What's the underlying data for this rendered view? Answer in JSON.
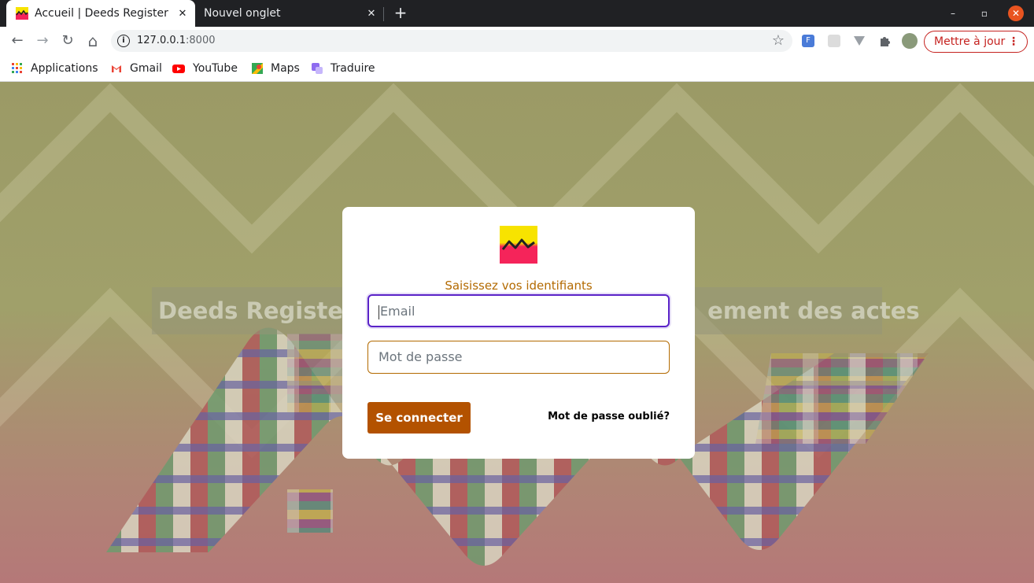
{
  "browser": {
    "tabs": [
      {
        "title": "Accueil | Deeds Register",
        "close": "✕"
      },
      {
        "title": "Nouvel onglet",
        "close": "✕"
      }
    ],
    "new_tab": "+",
    "window_controls": {
      "minimize": "–",
      "maximize": "▫",
      "close": "✕"
    },
    "nav": {
      "back": "←",
      "forward": "→",
      "reload": "↻",
      "home": "⌂"
    },
    "omnibox": {
      "host": "127.0.0.1",
      "port": ":8000",
      "info": "i",
      "star": "☆"
    },
    "update_button": {
      "label": "Mettre à jour",
      "menu": "⋮"
    },
    "bookmarks": [
      {
        "label": "Applications",
        "icon": "apps-grid-icon"
      },
      {
        "label": "Gmail",
        "icon": "gmail-icon"
      },
      {
        "label": "YouTube",
        "icon": "youtube-icon"
      },
      {
        "label": "Maps",
        "icon": "maps-icon"
      },
      {
        "label": "Traduire",
        "icon": "translate-icon"
      }
    ],
    "extension_icons": [
      "fi-extension-icon",
      "grid-extension-icon",
      "vue-extension-icon",
      "puzzle-extensions-icon",
      "profile-avatar-icon"
    ]
  },
  "page": {
    "background_heading_left": "Deeds Register, ",
    "background_heading_right": "ement des actes",
    "login": {
      "subtitle": "Saisissez vos identifiants",
      "email_placeholder": "Email",
      "password_placeholder": "Mot de passe",
      "submit_label": "Se connecter",
      "forgot_label": "Mot de passe oublié?"
    }
  },
  "colors": {
    "accent": "#b35200",
    "subtitle": "#b36a00",
    "focus_ring": "#5a23c8",
    "logo_top": "#f7e300",
    "logo_bottom": "#f5245a"
  }
}
